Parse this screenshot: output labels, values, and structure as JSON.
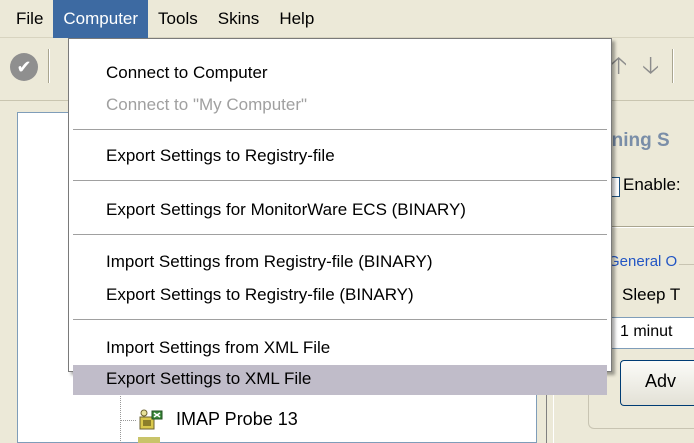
{
  "menubar": {
    "items": [
      {
        "label": "File"
      },
      {
        "label": "Computer",
        "active": true
      },
      {
        "label": "Tools"
      },
      {
        "label": "Skins"
      },
      {
        "label": "Help"
      }
    ]
  },
  "toolbar": {
    "icons": [
      "check-icon",
      "arrow-up-icon",
      "arrow-down-icon"
    ]
  },
  "computer_menu": {
    "items": [
      {
        "label": "Connect to Computer",
        "enabled": true
      },
      {
        "label": "Connect to \"My Computer\"",
        "enabled": false
      },
      {
        "label": "Export Settings to Registry-file",
        "enabled": true
      },
      {
        "label": "Export Settings for MonitorWare ECS (BINARY)",
        "enabled": true
      },
      {
        "label": "Import Settings from Registry-file (BINARY)",
        "enabled": true
      },
      {
        "label": "Export Settings to Registry-file (BINARY)",
        "enabled": true
      },
      {
        "label": "Import Settings from XML File",
        "enabled": true
      },
      {
        "label": "Export Settings to XML File",
        "enabled": true,
        "selected": true
      }
    ],
    "selected_color": "#c0bcc9"
  },
  "tree": {
    "visible_item": {
      "label": "IMAP Probe 13",
      "icon": "imap-probe-icon"
    }
  },
  "right_panel": {
    "title_fragment": "nning S",
    "enable_label": "Enable:",
    "group_title": "General O",
    "sleep_label": "Sleep T",
    "sleep_value": "1 minut",
    "button_label": "Adv"
  },
  "colors": {
    "menu_active": "#3d6aa2",
    "background": "#ece9d8",
    "group_title": "#2255c4"
  }
}
